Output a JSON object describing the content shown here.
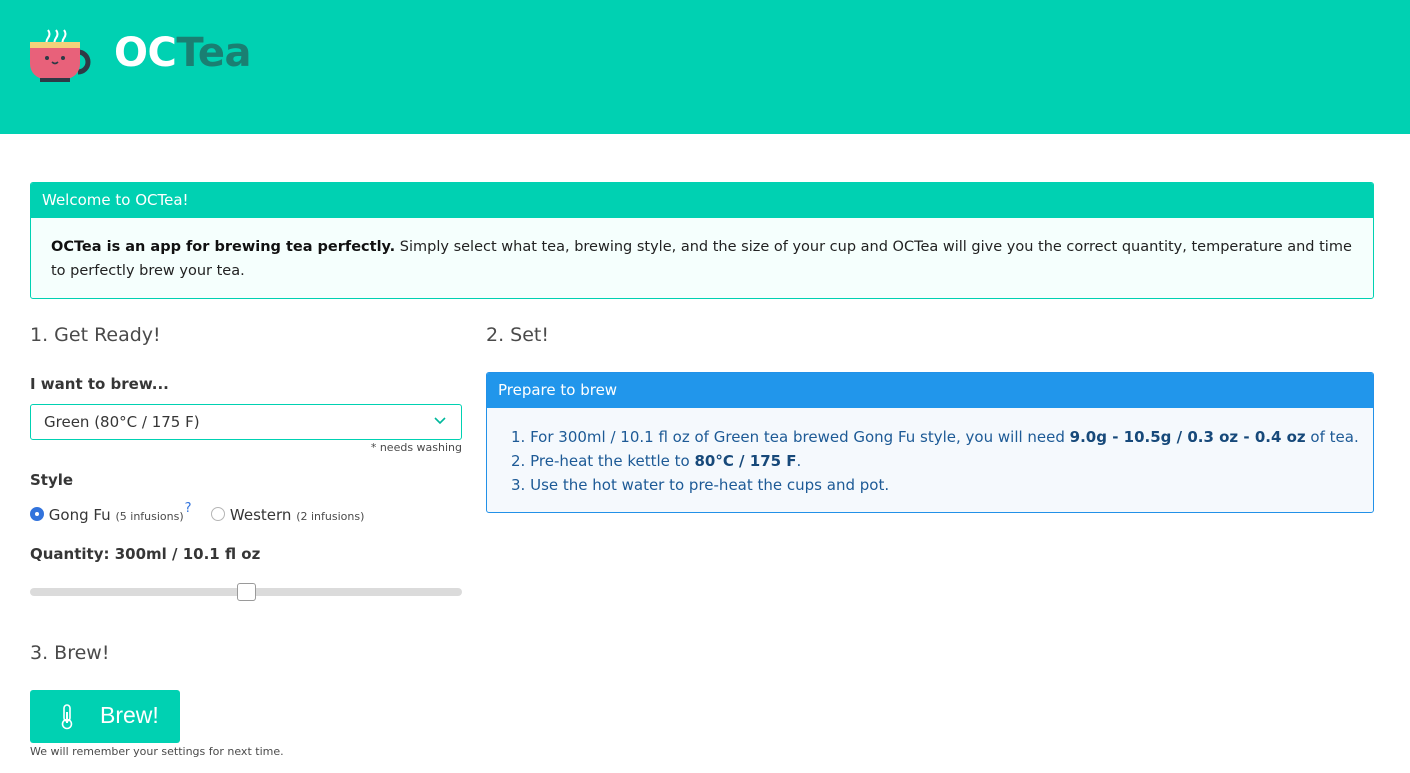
{
  "header": {
    "logo_oc": "OC",
    "logo_tea": "Tea",
    "brand_color": "#00d1b2"
  },
  "welcome": {
    "title": "Welcome to OCTea!",
    "intro_bold": "OCTea is an app for brewing tea perfectly.",
    "intro_text": " Simply select what tea, brewing style, and the size of your cup and OCTea will give you the correct quantity, temperature and time to perfectly brew your tea."
  },
  "step1": {
    "title": "1. Get Ready!",
    "brew_label": "I want to brew...",
    "tea_select_value": "Green (80°C / 175 F)",
    "washing_note": "* needs washing",
    "style_label": "Style",
    "style_options": [
      {
        "label": "Gong Fu",
        "note": "(5 infusions)",
        "help": "?",
        "selected": true
      },
      {
        "label": "Western",
        "note": "(2 infusions)",
        "selected": false
      }
    ],
    "quantity_label": "Quantity: 300ml / 10.1 fl oz",
    "quantity_slider_fraction": 0.5
  },
  "step2": {
    "title": "2. Set!",
    "box_title": "Prepare to brew",
    "steps": [
      {
        "num": "1.",
        "pre": "For 300ml / 10.1 fl oz of Green tea brewed Gong Fu style, you will need ",
        "bold": "9.0g - 10.5g / 0.3 oz - 0.4 oz",
        "post": " of tea."
      },
      {
        "num": "2.",
        "pre": "Pre-heat the kettle to ",
        "bold": "80°C / 175 F",
        "post": "."
      },
      {
        "num": "3.",
        "pre": "Use the hot water to pre-heat the cups and pot.",
        "bold": "",
        "post": ""
      }
    ]
  },
  "step3": {
    "title": "3. Brew!",
    "button_label": "Brew!",
    "remember_note": "We will remember your settings for next time."
  }
}
